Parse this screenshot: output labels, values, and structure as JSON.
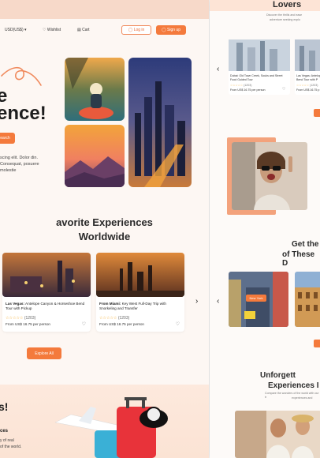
{
  "nav": {
    "currency": "USD(US$)",
    "wishlist": "Wishlist",
    "cart": "Cart",
    "login": "Log in",
    "signup": "Sign up"
  },
  "hero": {
    "line1": "e",
    "line2": "ence!",
    "button": "earch",
    "paragraph": "scing elit. Dolor din. Consequat, posuere molestie"
  },
  "favorites": {
    "title_line1": "avorite Experiences",
    "title_line2": "Worldwide",
    "cards": [
      {
        "title_bold": "Las Vegas:",
        "title_rest": "Antelope Canyon & Horseshoe Bend Tour with Pickup",
        "reviews": "(1203)",
        "price": "From US$ 16.75 per person"
      },
      {
        "title_bold": "From Miami:",
        "title_rest": "Key West Full-Day Trip with Snorkeling and Transfer",
        "reviews": "(1203)",
        "price": "From US$ 16.75 per person"
      }
    ],
    "explore": "Explore All"
  },
  "bottom": {
    "heading": "s!",
    "sub": "ces",
    "text_line1": "y of real",
    "text_line2": "of the world."
  },
  "right": {
    "lovers": "Lovers",
    "lovers_sub1": "Discover the thrills and ease",
    "lovers_sub2": "adventure seeking explo",
    "card1_title": "Dubai: Old Town Creek, Souks and Street Food Guided Tour",
    "card1_reviews": "(1203)",
    "card1_price": "From US$ 16.75 per person",
    "card2_title": "Las Vegas: Antelop Bend Tour with P",
    "card2_reviews": "(1203)",
    "card2_price": "From US$ 16.75 p",
    "get_line1": "Get the",
    "get_line2": "of These D",
    "new_york": "New York",
    "unforget_line1": "Unforgett",
    "unforget_line2": "Experiences I",
    "unforget_sub1": "Compare the wonders of the world with our tr",
    "unforget_sub2": "experiences and"
  },
  "colors": {
    "accent": "#f47a3c",
    "cream": "#fdf7f3",
    "band": "#f7d9c9"
  }
}
